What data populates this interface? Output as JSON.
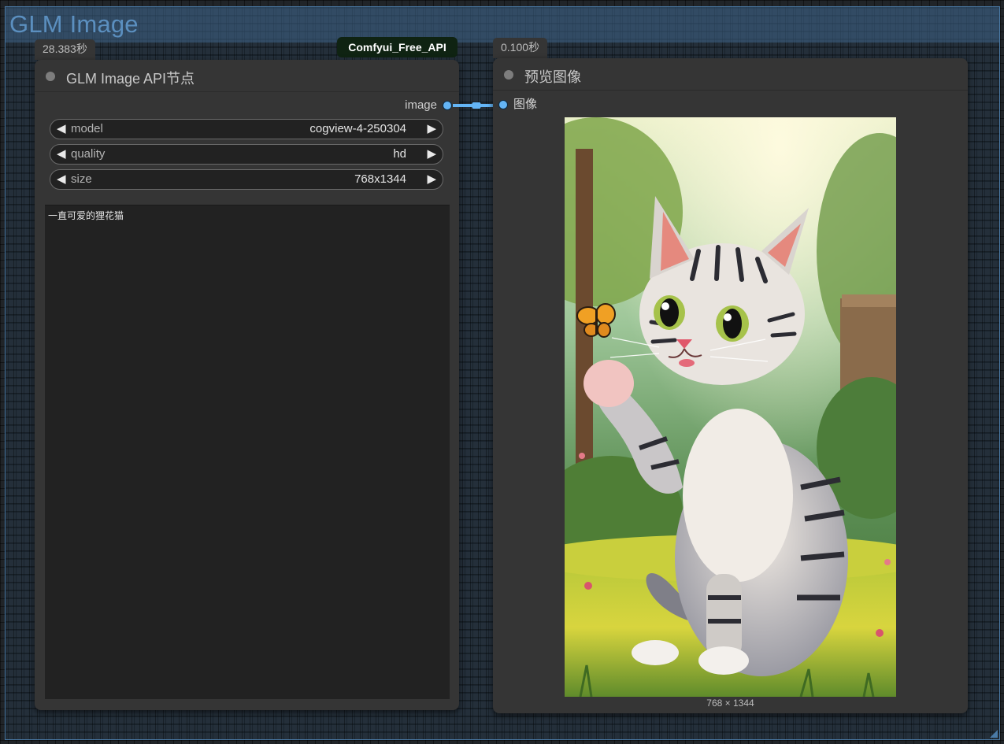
{
  "group": {
    "title": "GLM Image"
  },
  "node_glm": {
    "timing": "28.383秒",
    "title": "GLM Image API节点",
    "output_label": "image",
    "widgets": [
      {
        "name": "model",
        "value": "cogview-4-250304"
      },
      {
        "name": "quality",
        "value": "hd"
      },
      {
        "name": "size",
        "value": "768x1344"
      }
    ],
    "prompt": "一直可爱的狸花猫"
  },
  "tag": {
    "label": "Comfyui_Free_API"
  },
  "node_preview": {
    "timing": "0.100秒",
    "title": "预览图像",
    "input_label": "图像",
    "image_caption": "768 × 1344",
    "image_alt": "tabby-kitten-with-butterfly"
  },
  "colors": {
    "link": "#64b5f6",
    "group_border": "#4a7aa6",
    "group_title": "#5b8fbf",
    "tag_bg": "#0f2312"
  }
}
